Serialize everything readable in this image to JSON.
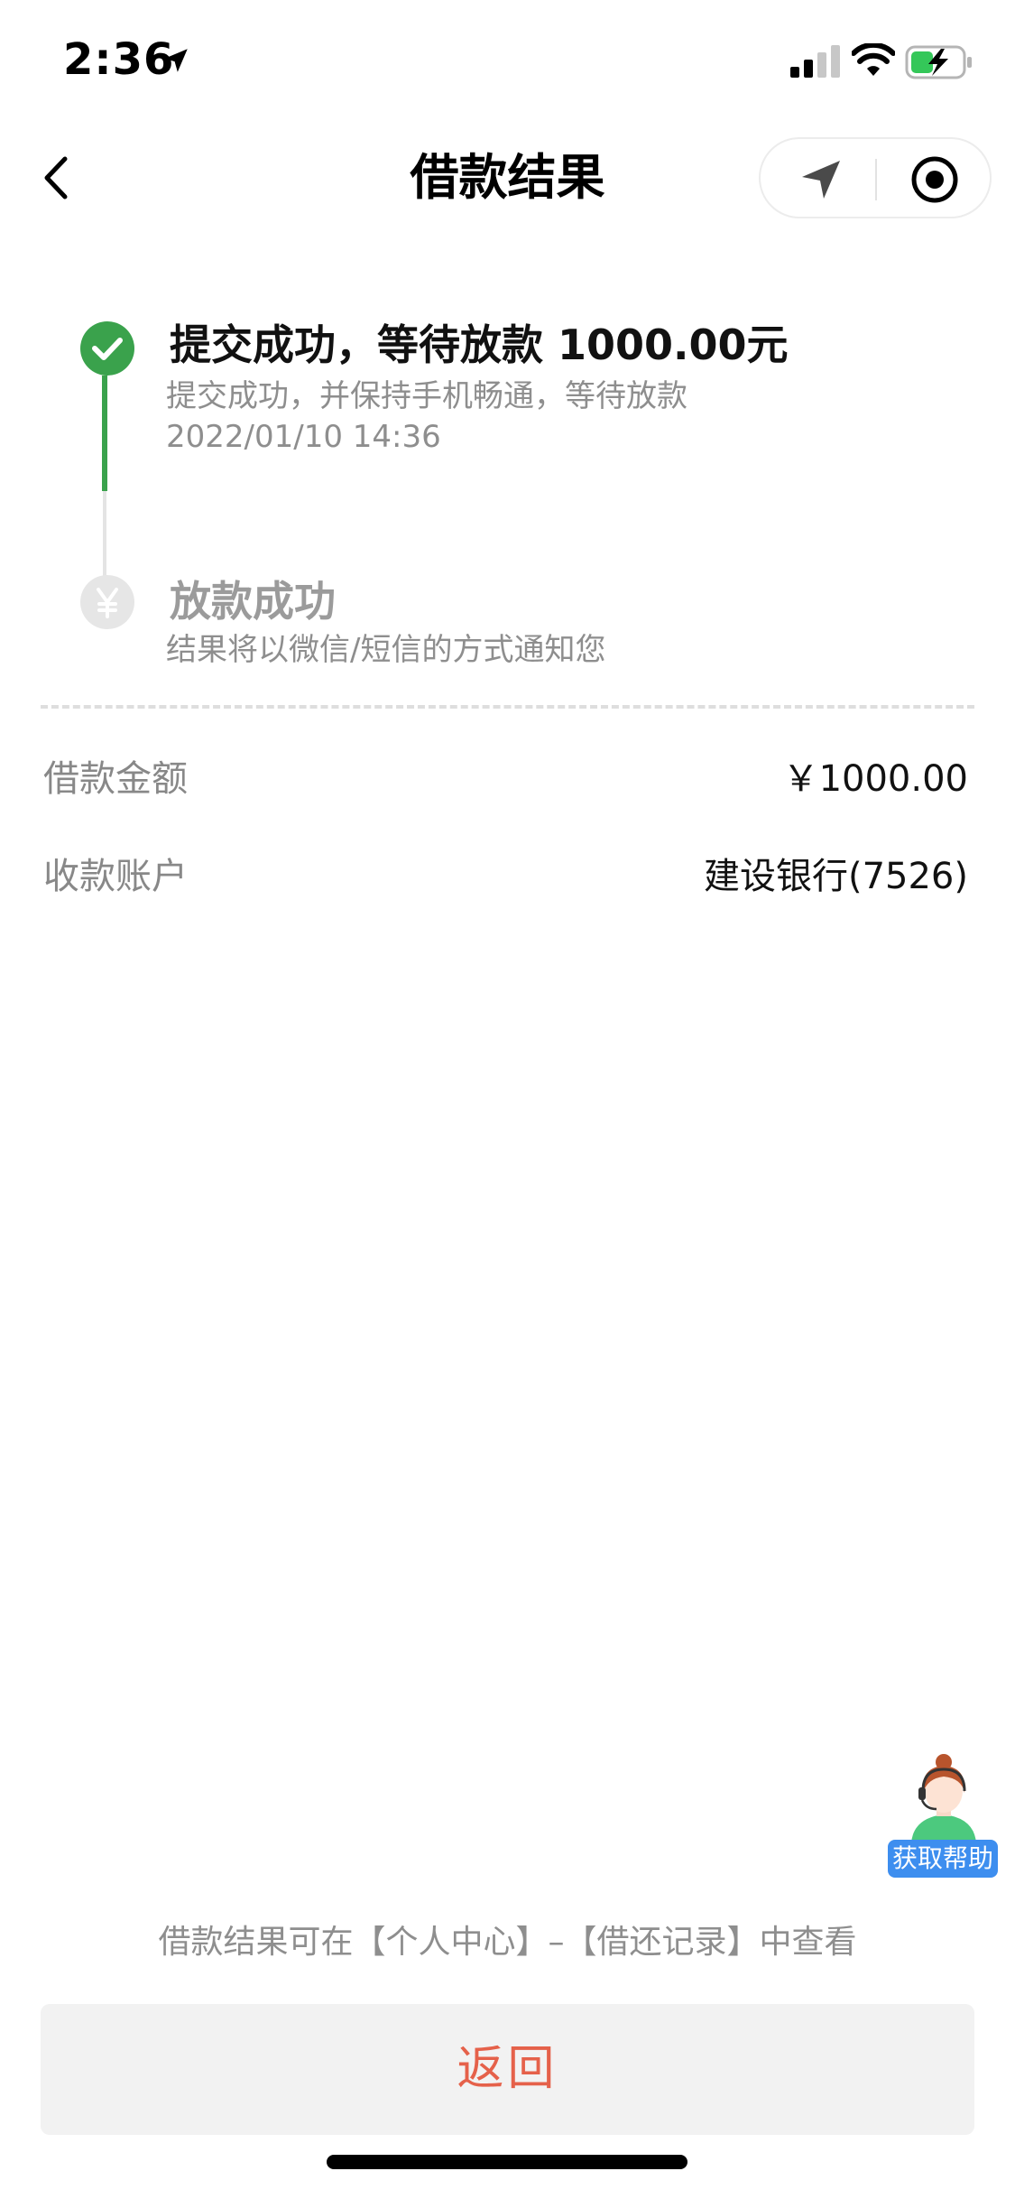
{
  "status_bar": {
    "time": "2:36"
  },
  "nav": {
    "title": "借款结果"
  },
  "timeline": [
    {
      "title": "提交成功，等待放款 1000.00元",
      "subtitle": "提交成功，并保持手机畅通，等待放款",
      "time": "2022/01/10 14:36",
      "state": "done",
      "icon": "check-icon"
    },
    {
      "title": "放款成功",
      "subtitle": "结果将以微信/短信的方式通知您",
      "state": "pending",
      "icon": "yuan-icon"
    }
  ],
  "details": [
    {
      "label": "借款金额",
      "value": "￥1000.00"
    },
    {
      "label": "收款账户",
      "value": "建设银行(7526)"
    }
  ],
  "help": {
    "label": "获取帮助"
  },
  "hint": "借款结果可在【个人中心】–【借还记录】中查看",
  "return_button": {
    "label": "返回"
  },
  "colors": {
    "success": "#3aa24c",
    "accent": "#e5614a",
    "help": "#3d8eef"
  }
}
